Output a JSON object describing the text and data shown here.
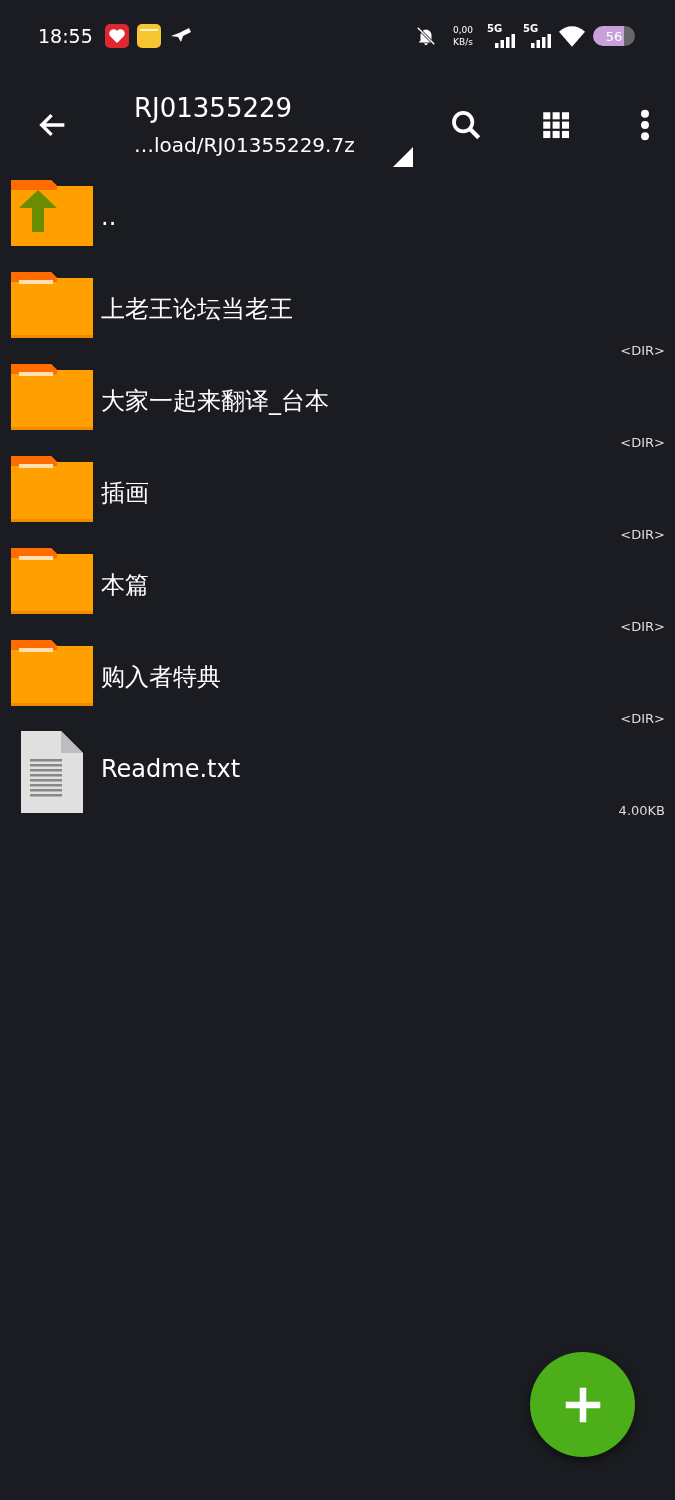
{
  "status_bar": {
    "time": "18:55",
    "net_speed": "0,00",
    "net_unit": "KB/s",
    "signal_1": "5G",
    "signal_2": "5G",
    "battery": "56"
  },
  "toolbar": {
    "title": "RJ01355229",
    "path": "…load/RJ01355229.7z"
  },
  "items": [
    {
      "kind": "up",
      "name": ".."
    },
    {
      "kind": "folder",
      "name": "上老王论坛当老王",
      "info": "<DIR>"
    },
    {
      "kind": "folder",
      "name": "大家一起来翻译_台本",
      "info": "<DIR>"
    },
    {
      "kind": "folder",
      "name": "插画",
      "info": "<DIR>"
    },
    {
      "kind": "folder",
      "name": "本篇",
      "info": "<DIR>"
    },
    {
      "kind": "folder",
      "name": "购入者特典",
      "info": "<DIR>"
    },
    {
      "kind": "file",
      "name": "Readme.txt",
      "info": "4.00KB"
    }
  ]
}
